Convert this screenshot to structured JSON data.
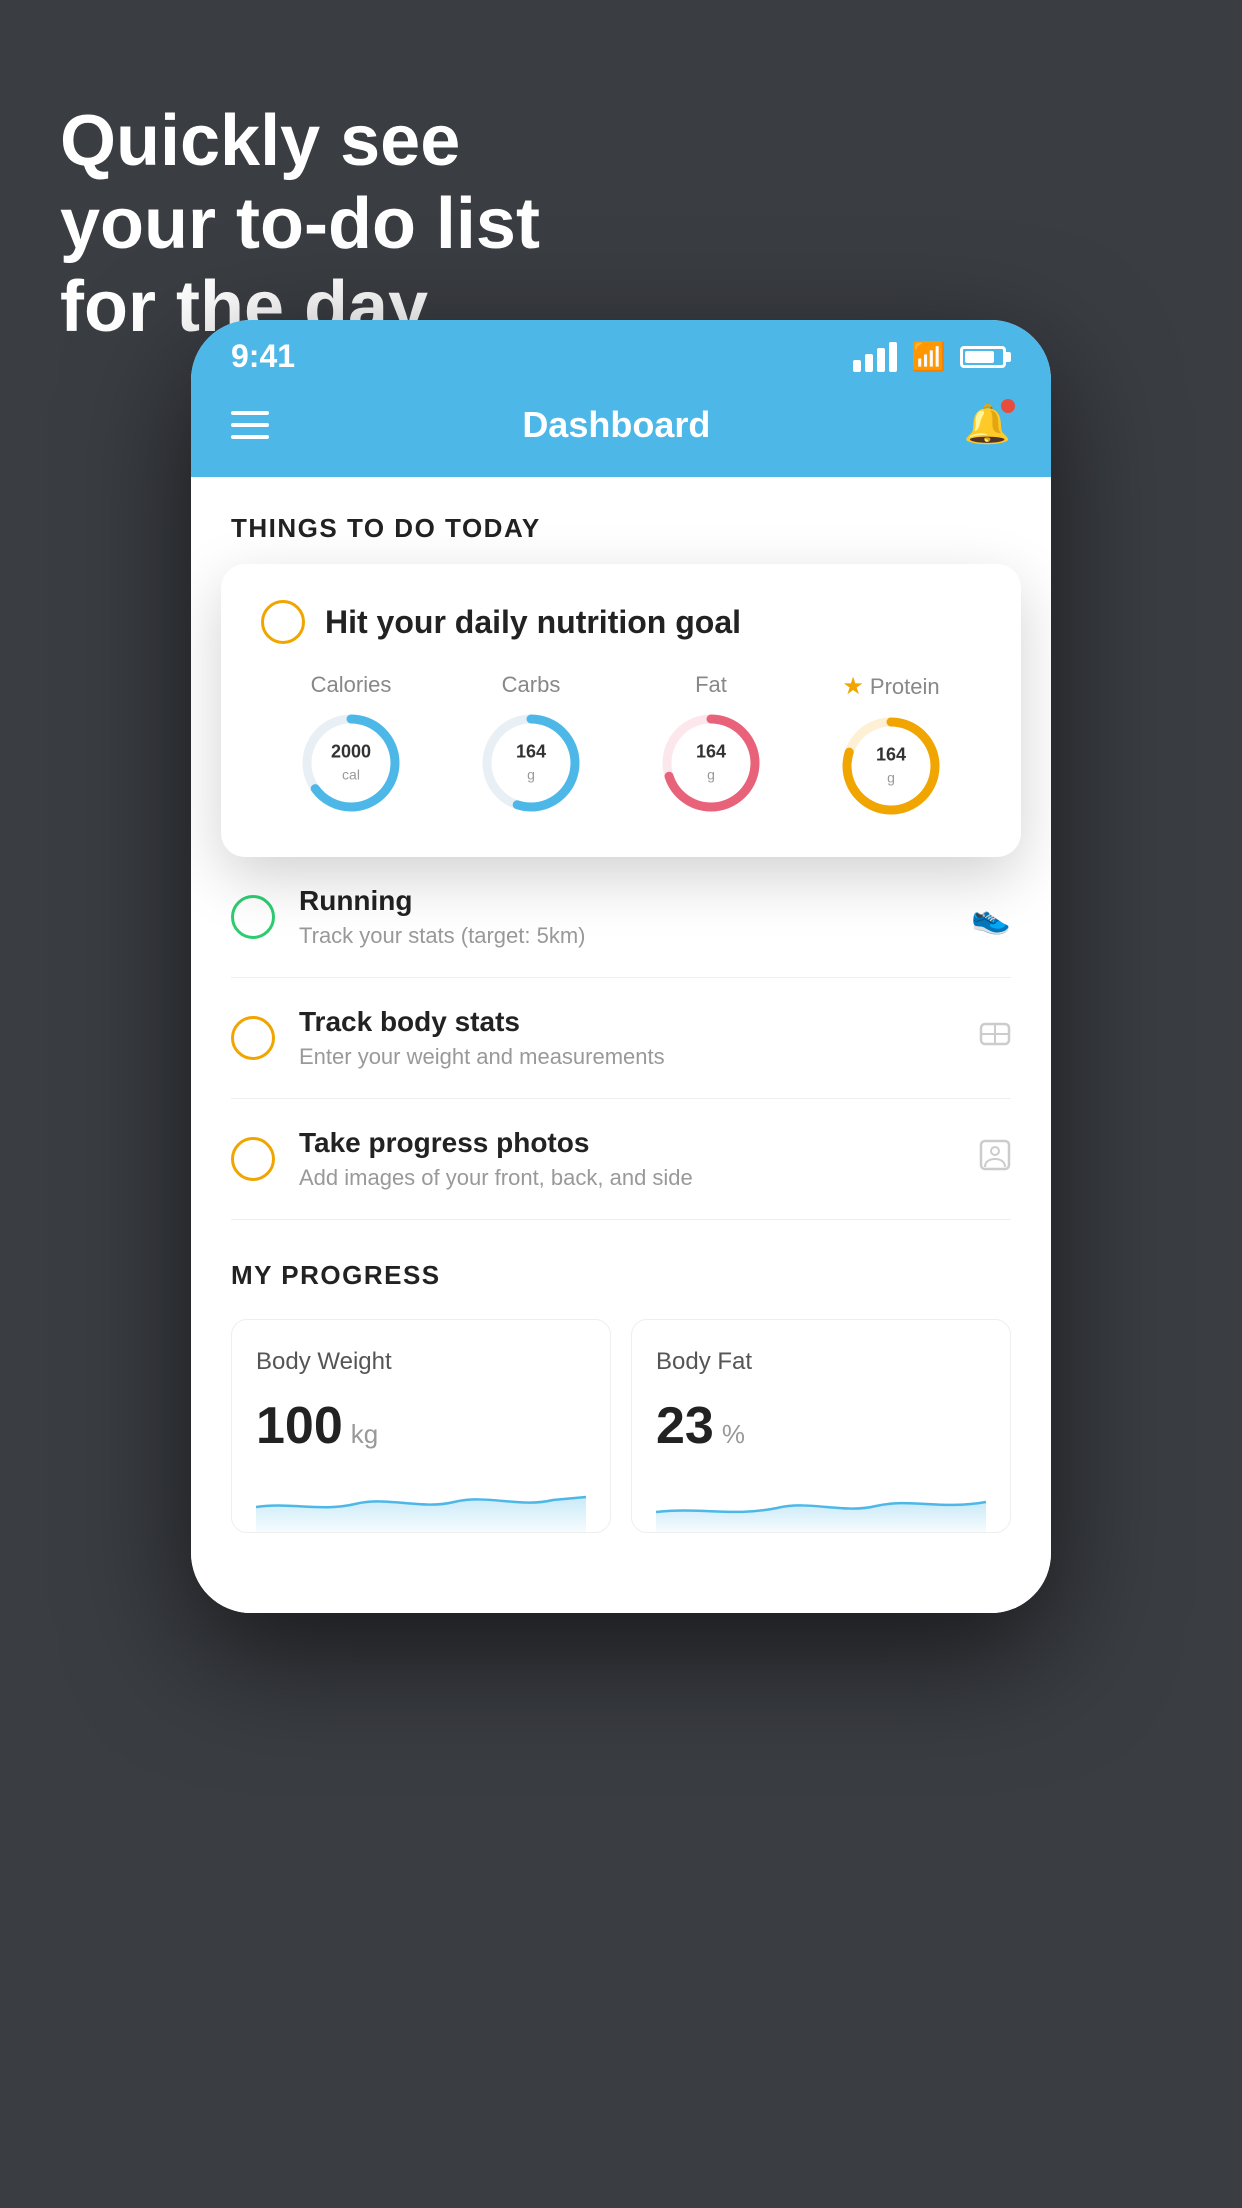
{
  "background_color": "#3a3d42",
  "headline": {
    "line1": "Quickly see",
    "line2": "your to-do list",
    "line3": "for the day."
  },
  "status_bar": {
    "time": "9:41",
    "signal": "signal",
    "wifi": "wifi",
    "battery": "battery"
  },
  "nav": {
    "title": "Dashboard",
    "menu_label": "menu",
    "bell_label": "notifications"
  },
  "section_header": "THINGS TO DO TODAY",
  "floating_card": {
    "checkbox_color": "#f0a500",
    "title": "Hit your daily nutrition goal",
    "nutrition": [
      {
        "label": "Calories",
        "value": "2000",
        "unit": "cal",
        "color": "#4db8e8",
        "percent": 65
      },
      {
        "label": "Carbs",
        "value": "164",
        "unit": "g",
        "color": "#4db8e8",
        "percent": 55
      },
      {
        "label": "Fat",
        "value": "164",
        "unit": "g",
        "color": "#e8627a",
        "percent": 70
      },
      {
        "label": "Protein",
        "value": "164",
        "unit": "g",
        "color": "#f0a500",
        "percent": 80,
        "starred": true
      }
    ]
  },
  "todo_items": [
    {
      "type": "green",
      "title": "Running",
      "subtitle": "Track your stats (target: 5km)",
      "icon": "shoe"
    },
    {
      "type": "yellow",
      "title": "Track body stats",
      "subtitle": "Enter your weight and measurements",
      "icon": "scale"
    },
    {
      "type": "yellow",
      "title": "Take progress photos",
      "subtitle": "Add images of your front, back, and side",
      "icon": "person"
    }
  ],
  "progress_section": {
    "header": "MY PROGRESS",
    "cards": [
      {
        "title": "Body Weight",
        "value": "100",
        "unit": "kg"
      },
      {
        "title": "Body Fat",
        "value": "23",
        "unit": "%"
      }
    ]
  }
}
